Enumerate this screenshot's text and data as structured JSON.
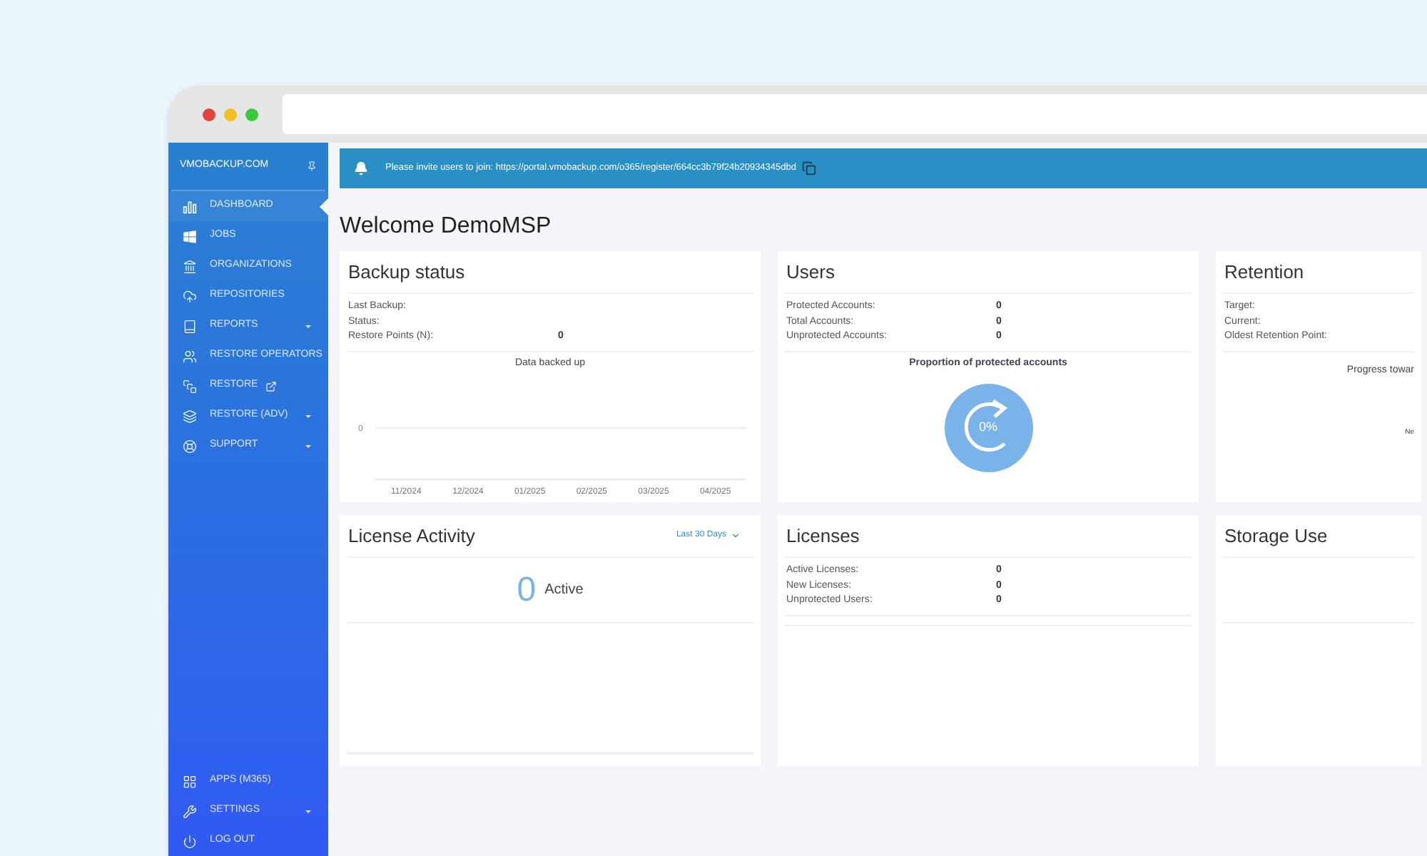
{
  "sidebar": {
    "brand": "VMOBACKUP.COM",
    "items": [
      {
        "label": "DASHBOARD",
        "selected": true,
        "dropdown": false,
        "external": false
      },
      {
        "label": "JOBS",
        "selected": false,
        "dropdown": false,
        "external": false
      },
      {
        "label": "ORGANIZATIONS",
        "selected": false,
        "dropdown": false,
        "external": false
      },
      {
        "label": "REPOSITORIES",
        "selected": false,
        "dropdown": false,
        "external": false
      },
      {
        "label": "REPORTS",
        "selected": false,
        "dropdown": true,
        "external": false
      },
      {
        "label": "RESTORE OPERATORS",
        "selected": false,
        "dropdown": false,
        "external": false
      },
      {
        "label": "RESTORE",
        "selected": false,
        "dropdown": false,
        "external": true
      },
      {
        "label": "RESTORE (ADV)",
        "selected": false,
        "dropdown": true,
        "external": false
      },
      {
        "label": "SUPPORT",
        "selected": false,
        "dropdown": true,
        "external": false
      }
    ],
    "bottom_items": [
      {
        "label": "APPS (M365)",
        "dropdown": false
      },
      {
        "label": "SETTINGS",
        "dropdown": true
      },
      {
        "label": "LOG OUT",
        "dropdown": false
      }
    ]
  },
  "banner": {
    "text": "Please invite users to join: https://portal.vmobackup.com/o365/register/664cc3b79f24b20934345dbd"
  },
  "title": "Welcome DemoMSP",
  "backup_status": {
    "title": "Backup status",
    "rows": [
      {
        "label": "Last Backup:",
        "value": ""
      },
      {
        "label": "Status:",
        "value": ""
      },
      {
        "label": "Restore Points (N):",
        "value": "0"
      }
    ],
    "chart_title": "Data backed up",
    "y_label": "0",
    "x_labels": [
      "11/2024",
      "12/2024",
      "01/2025",
      "02/2025",
      "03/2025",
      "04/2025"
    ]
  },
  "users": {
    "title": "Users",
    "rows": [
      {
        "label": "Protected Accounts:",
        "value": "0"
      },
      {
        "label": "Total Accounts:",
        "value": "0"
      },
      {
        "label": "Unprotected Accounts:",
        "value": "0"
      }
    ],
    "proportion_title": "Proportion of protected accounts",
    "proportion": "0%"
  },
  "retention": {
    "title": "Retention",
    "rows": [
      {
        "label": "Target:"
      },
      {
        "label": "Current:"
      },
      {
        "label": "Oldest Retention Point:"
      }
    ],
    "progress_title": "Progress towar",
    "note": "Ne"
  },
  "license_activity": {
    "title": "License Activity",
    "range": "Last 30 Days",
    "count": "0",
    "count_label": "Active"
  },
  "licenses": {
    "title": "Licenses",
    "rows": [
      {
        "label": "Active Licenses:",
        "value": "0"
      },
      {
        "label": "New Licenses:",
        "value": "0"
      },
      {
        "label": "Unprotected Users:",
        "value": "0"
      }
    ]
  },
  "storage": {
    "title": "Storage Use"
  }
}
